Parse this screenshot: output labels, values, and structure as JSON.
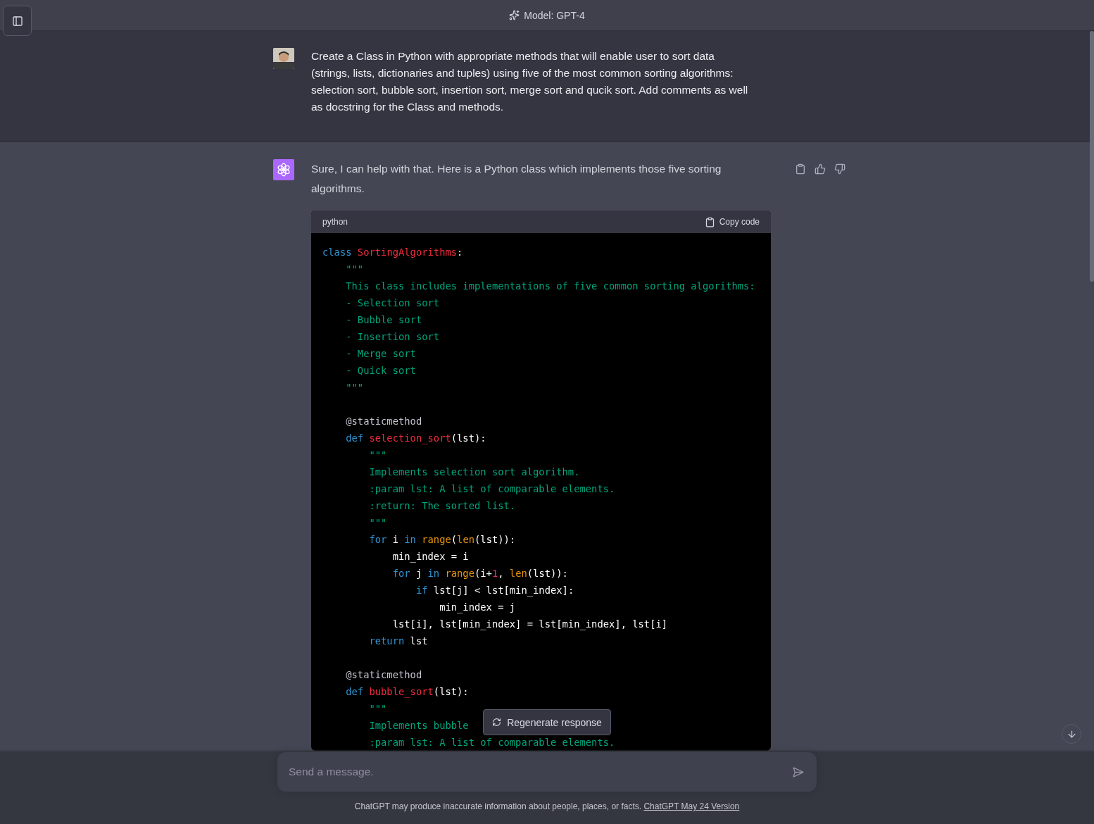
{
  "header": {
    "model_label": "Model: GPT-4"
  },
  "messages": [
    {
      "kind": "user",
      "text": "Create a Class in Python with appropriate methods that will enable user to sort data (strings, lists, dictionaries and tuples) using five of the most common sorting algorithms: selection sort, bubble sort, insertion sort, merge sort and qucik sort. Add comments as well as docstring for the Class and methods."
    },
    {
      "kind": "assistant",
      "text": "Sure, I can help with that. Here is a Python class which implements those five sorting algorithms.",
      "code_block": {
        "language": "python",
        "copy_label": "Copy code",
        "lines": [
          {
            "tokens": [
              {
                "kind": "kw",
                "text": "class "
              },
              {
                "kind": "name",
                "text": "SortingAlgorithms"
              },
              {
                "kind": "plain",
                "text": ":"
              }
            ]
          },
          {
            "tokens": [
              {
                "kind": "str",
                "text": "    \"\"\""
              }
            ]
          },
          {
            "tokens": [
              {
                "kind": "str",
                "text": "    This class includes implementations of five common sorting algorithms:"
              }
            ]
          },
          {
            "tokens": [
              {
                "kind": "str",
                "text": "    - Selection sort"
              }
            ]
          },
          {
            "tokens": [
              {
                "kind": "str",
                "text": "    - Bubble sort"
              }
            ]
          },
          {
            "tokens": [
              {
                "kind": "str",
                "text": "    - Insertion sort"
              }
            ]
          },
          {
            "tokens": [
              {
                "kind": "str",
                "text": "    - Merge sort"
              }
            ]
          },
          {
            "tokens": [
              {
                "kind": "str",
                "text": "    - Quick sort"
              }
            ]
          },
          {
            "tokens": [
              {
                "kind": "str",
                "text": "    \"\"\""
              }
            ]
          },
          {
            "gap_before": true,
            "tokens": [
              {
                "kind": "deco",
                "text": "    @staticmethod"
              }
            ]
          },
          {
            "tokens": [
              {
                "kind": "kw",
                "text": "    def "
              },
              {
                "kind": "name",
                "text": "selection_sort"
              },
              {
                "kind": "plain",
                "text": "(lst):"
              }
            ]
          },
          {
            "tokens": [
              {
                "kind": "str",
                "text": "        \"\"\""
              }
            ]
          },
          {
            "tokens": [
              {
                "kind": "str",
                "text": "        Implements selection sort algorithm."
              }
            ]
          },
          {
            "tokens": [
              {
                "kind": "str",
                "text": "        :param lst: A list of comparable elements."
              }
            ]
          },
          {
            "tokens": [
              {
                "kind": "str",
                "text": "        :return: The sorted list."
              }
            ]
          },
          {
            "tokens": [
              {
                "kind": "str",
                "text": "        \"\"\""
              }
            ]
          },
          {
            "tokens": [
              {
                "kind": "kw",
                "text": "        for "
              },
              {
                "kind": "plain",
                "text": "i "
              },
              {
                "kind": "kw",
                "text": "in "
              },
              {
                "kind": "builtin",
                "text": "range"
              },
              {
                "kind": "plain",
                "text": "("
              },
              {
                "kind": "builtin",
                "text": "len"
              },
              {
                "kind": "plain",
                "text": "(lst)):"
              }
            ]
          },
          {
            "tokens": [
              {
                "kind": "plain",
                "text": "            min_index = i"
              }
            ]
          },
          {
            "tokens": [
              {
                "kind": "kw",
                "text": "            for "
              },
              {
                "kind": "plain",
                "text": "j "
              },
              {
                "kind": "kw",
                "text": "in "
              },
              {
                "kind": "builtin",
                "text": "range"
              },
              {
                "kind": "plain",
                "text": "(i+"
              },
              {
                "kind": "num",
                "text": "1"
              },
              {
                "kind": "plain",
                "text": ", "
              },
              {
                "kind": "builtin",
                "text": "len"
              },
              {
                "kind": "plain",
                "text": "(lst)):"
              }
            ]
          },
          {
            "tokens": [
              {
                "kind": "kw",
                "text": "                if "
              },
              {
                "kind": "plain",
                "text": "lst[j] < lst[min_index]:"
              }
            ]
          },
          {
            "tokens": [
              {
                "kind": "plain",
                "text": "                    min_index = j"
              }
            ]
          },
          {
            "tokens": [
              {
                "kind": "plain",
                "text": "            lst[i], lst[min_index] = lst[min_index], lst[i]"
              }
            ]
          },
          {
            "tokens": [
              {
                "kind": "kw",
                "text": "        return "
              },
              {
                "kind": "plain",
                "text": "lst"
              }
            ]
          },
          {
            "gap_before": true,
            "tokens": [
              {
                "kind": "deco",
                "text": "    @staticmethod"
              }
            ]
          },
          {
            "tokens": [
              {
                "kind": "kw",
                "text": "    def "
              },
              {
                "kind": "name",
                "text": "bubble_sort"
              },
              {
                "kind": "plain",
                "text": "(lst):"
              }
            ]
          },
          {
            "tokens": [
              {
                "kind": "str",
                "text": "        \"\"\""
              }
            ]
          },
          {
            "tokens": [
              {
                "kind": "str",
                "text": "        Implements bubble"
              }
            ]
          },
          {
            "tokens": [
              {
                "kind": "str",
                "text": "        :param lst: A list of comparable elements."
              }
            ]
          }
        ]
      }
    }
  ],
  "regenerate_button": "Regenerate response",
  "composer": {
    "placeholder": "Send a message."
  },
  "footer": {
    "text": "ChatGPT may produce inaccurate information about people, places, or facts.",
    "link": "ChatGPT May 24 Version"
  }
}
